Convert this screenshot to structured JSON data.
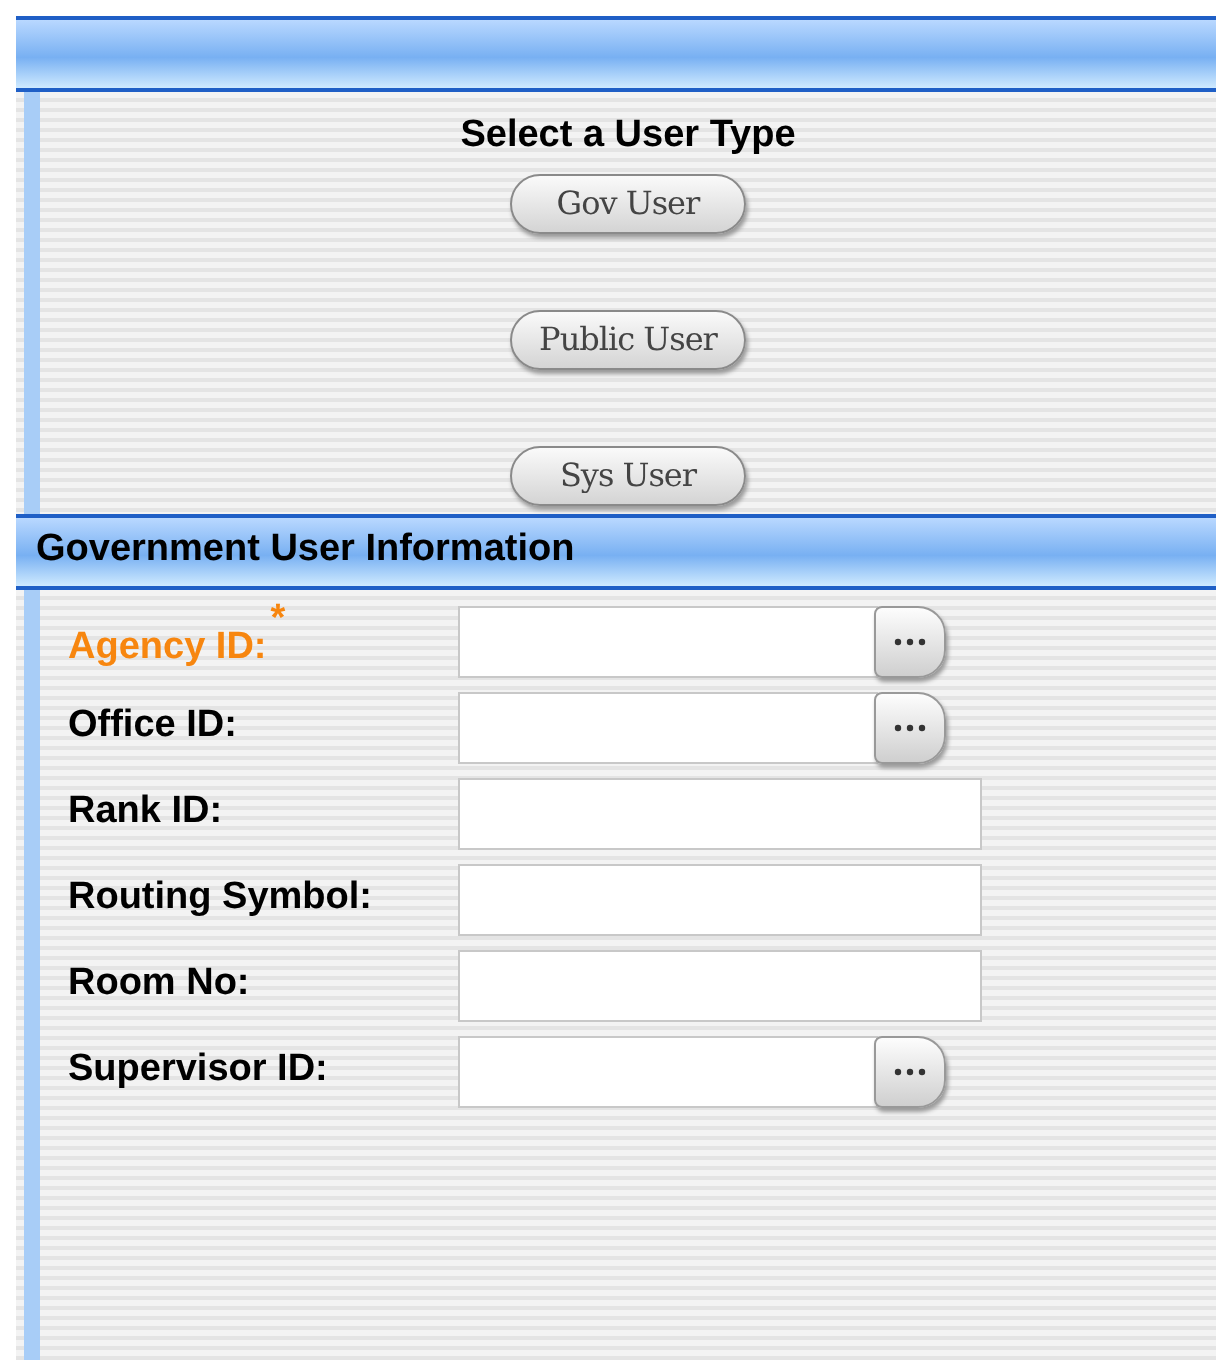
{
  "user_type": {
    "title": "Select a User Type",
    "buttons": [
      "Gov User",
      "Public User",
      "Sys User"
    ]
  },
  "section": {
    "title": "Government User Information"
  },
  "fields": [
    {
      "label": "Agency ID:",
      "required": true,
      "required_mark": "*",
      "kind": "lookup"
    },
    {
      "label": "Office ID:",
      "required": false,
      "kind": "lookup"
    },
    {
      "label": "Rank ID:",
      "required": false,
      "kind": "text"
    },
    {
      "label": "Routing Symbol:",
      "required": false,
      "kind": "text"
    },
    {
      "label": "Room No:",
      "required": false,
      "kind": "text"
    },
    {
      "label": "Supervisor ID:",
      "required": false,
      "kind": "lookup"
    }
  ]
}
